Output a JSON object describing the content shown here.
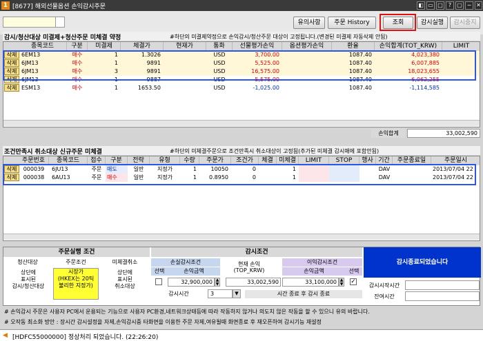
{
  "window": {
    "num": "1",
    "title": "[8677] 해외선물옵션 손익감시주문"
  },
  "toolbar": {
    "btn_memo": "유의사항",
    "btn_history": "주문 History",
    "btn_search": "조회",
    "btn_run": "감시실행",
    "btn_stop": "감시중지"
  },
  "sec1": {
    "title": "감시/청산대상 미결제+청산주문 미체결 약정",
    "note": "#하단의 미결제약정으로 손익감시/청산주문 대상이 고정됩니다.(변경된 미결제 자동삭제 안됨)",
    "headers": [
      "종목코드",
      "구분",
      "미결제",
      "체결가",
      "현재가",
      "통화",
      "선물평가손익",
      "옵션평가손익",
      "환율",
      "손익합계(TOT_KRW)",
      "LIMIT"
    ],
    "rows": [
      {
        "del": "삭제",
        "code": "6EM13",
        "side": "매수",
        "qty": "1",
        "price": "1.3026",
        "cur": "USD",
        "fut": "3,700.00",
        "opt": "",
        "fx": "1087.40",
        "sum": "4,023,380"
      },
      {
        "del": "삭제",
        "code": "6JM13",
        "side": "매수",
        "qty": "1",
        "price": "9891",
        "cur": "USD",
        "fut": "5,525.00",
        "opt": "",
        "fx": "1087.40",
        "sum": "6,007,885"
      },
      {
        "del": "삭제",
        "code": "6JM13",
        "side": "매수",
        "qty": "3",
        "price": "9891",
        "cur": "USD",
        "fut": "16,575.00",
        "opt": "",
        "fx": "1087.40",
        "sum": "18,023,655"
      },
      {
        "del": "삭제",
        "code": "6JM13",
        "side": "매수",
        "qty": "1",
        "price": "9887",
        "cur": "USD",
        "fut": "5,575.00",
        "opt": "",
        "fx": "1087.40",
        "sum": "6,062,255"
      },
      {
        "del": "삭제",
        "code": "ESM13",
        "side": "매수",
        "qty": "1",
        "price": "1653.50",
        "cur": "USD",
        "fut": "-1,025.00",
        "opt": "",
        "fx": "1087.40",
        "sum": "-1,114,585"
      }
    ],
    "total_label": "손익합계",
    "total_value": "33,002,590"
  },
  "sec2": {
    "title": "조건만족시 취소대상 신규주문 미체결",
    "note": "#하단의 미체결주문으로 조건만족시 취소대상이 고정됨(추가된 미체결 감시매에 포함안됨)",
    "headers": [
      "주문번호",
      "종목코드",
      "접수",
      "구분",
      "전략",
      "유형",
      "수량",
      "주문가",
      "조건가",
      "체결",
      "미체결",
      "LIMIT",
      "STOP",
      "행사",
      "기간",
      "주문종료일",
      "주문일시"
    ],
    "rows": [
      {
        "del": "삭제",
        "no": "000039",
        "code": "6JU13",
        "rcv": "주문",
        "side": "매도",
        "str": "일반",
        "type": "지정가",
        "qty": "1",
        "price": "10050",
        "cond": "0",
        "fill": "",
        "unfill": "1",
        "period": "DAV",
        "date": "2013/07/04 22"
      },
      {
        "del": "삭제",
        "no": "000038",
        "code": "6AU13",
        "rcv": "주문",
        "side": "매수",
        "str": "일반",
        "type": "지정가",
        "qty": "1",
        "price": "0.8950",
        "cond": "0",
        "fill": "",
        "unfill": "1",
        "period": "DAV",
        "date": "2013/07/04 22"
      }
    ]
  },
  "bottom": {
    "order_cond_title": "주문실행 조건",
    "col1": "청산대상",
    "col2": "주문조건",
    "col3": "미체결취소",
    "v1": "상단에\n표시된\n감시/청산대상",
    "v2": "시장가\n(HKEX는 20틱\n불리한 지정가)",
    "v3": "상단에\n표시된\n취소대상",
    "watch_title": "감시조건",
    "loss_title": "손실감시조건",
    "cur_pnl": "현재 손익\n(TOP_KRW)",
    "profit_title": "이익감시조건",
    "sel": "선택",
    "loss_amt_label": "손익금액",
    "profit_amt_label": "손익금액",
    "loss_amt": "32,900,000",
    "cur_value": "33,002,590",
    "profit_amt": "33,100,000",
    "time_label": "감시시간",
    "time_value": "3",
    "time_note": "시간 종료 후 감시 종료",
    "status": "감시종료되었습니다",
    "start_label": "감시시작시간",
    "remain_label": "잔여시간"
  },
  "notes": [
    "# 손익감시 주문은 사용자 PC에서 운용되는 기능으로 사용자 PC환경,네트워크상태등에 따라 작동하지 않거나 의도치 않은 작동을 할 수 있으니 유의 바랍니다.",
    "# 오작동 최소화 방안 : 장시간 감시설정을 자제,손익감시중 타화면을 이용한 주문 자제,여유될때 화면종료 후 재오픈하여 감시기능 재설정"
  ],
  "statusbar": "[HDFC55000000] 정상처리 되었습니다. (22:26:20)"
}
